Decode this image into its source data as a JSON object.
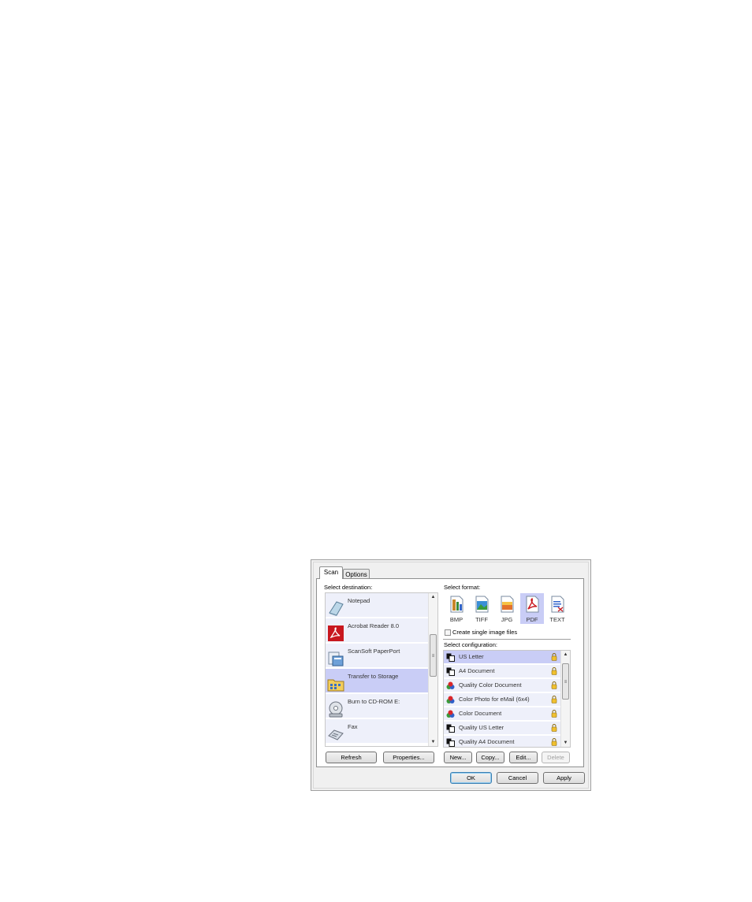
{
  "tabs": [
    {
      "label": "Scan",
      "selected": true
    },
    {
      "label": "Options",
      "selected": false
    }
  ],
  "destination": {
    "label": "Select destination:",
    "items": [
      {
        "label": "Notepad",
        "icon": "notepad-icon",
        "selected": false
      },
      {
        "label": "Acrobat Reader 8.0",
        "icon": "acrobat-icon",
        "selected": false
      },
      {
        "label": "ScanSoft PaperPort",
        "icon": "paperport-icon",
        "selected": false
      },
      {
        "label": "Transfer to Storage",
        "icon": "storage-folder-icon",
        "selected": true
      },
      {
        "label": "Burn to CD-ROM  E:",
        "icon": "cd-rom-icon",
        "selected": false
      },
      {
        "label": "Fax",
        "icon": "fax-icon",
        "selected": false
      }
    ],
    "refresh_label": "Refresh",
    "properties_label": "Properties..."
  },
  "format": {
    "label": "Select format:",
    "items": [
      {
        "label": "BMP",
        "icon": "bmp-format-icon",
        "selected": false
      },
      {
        "label": "TIFF",
        "icon": "tiff-format-icon",
        "selected": false
      },
      {
        "label": "JPG",
        "icon": "jpg-format-icon",
        "selected": false
      },
      {
        "label": "PDF",
        "icon": "pdf-format-icon",
        "selected": true
      },
      {
        "label": "TEXT",
        "icon": "text-format-icon",
        "selected": false
      }
    ],
    "single_image_label": "Create single image files",
    "single_image_checked": false
  },
  "configuration": {
    "label": "Select configuration:",
    "items": [
      {
        "label": "US Letter",
        "icon": "bw-document-icon",
        "selected": true
      },
      {
        "label": "A4 Document",
        "icon": "bw-document-icon",
        "selected": false
      },
      {
        "label": "Quality Color Document",
        "icon": "color-document-icon",
        "selected": false
      },
      {
        "label": "Color Photo for eMail (6x4)",
        "icon": "color-document-icon",
        "selected": false
      },
      {
        "label": "Color Document",
        "icon": "color-document-icon",
        "selected": false
      },
      {
        "label": "Quality US Letter",
        "icon": "bw-document-icon",
        "selected": false
      },
      {
        "label": "Quality A4 Document",
        "icon": "bw-document-icon",
        "selected": false
      }
    ],
    "new_label": "New...",
    "copy_label": "Copy...",
    "edit_label": "Edit...",
    "delete_label": "Delete"
  },
  "footer": {
    "ok_label": "OK",
    "cancel_label": "Cancel",
    "apply_label": "Apply"
  }
}
